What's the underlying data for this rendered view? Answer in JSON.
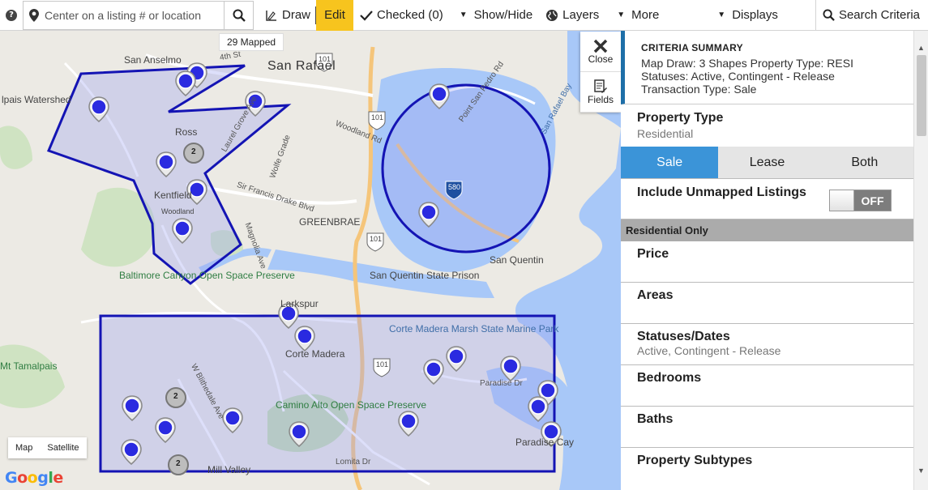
{
  "toolbar": {
    "help_icon": "?",
    "search_placeholder": "Center on a listing # or location",
    "draw_label": "Draw",
    "edit_label": "Edit",
    "checked_label": "Checked (0)",
    "showhide_label": "Show/Hide",
    "layers_label": "Layers",
    "more_label": "More",
    "displays_label": "Displays",
    "search_criteria_label": "Search Criteria"
  },
  "map": {
    "mapped_badge": "29 Mapped",
    "map_type_options": [
      "Map",
      "Satellite"
    ],
    "google_logo": "Google",
    "places": {
      "san_anselmo": "San Anselmo",
      "san_rafael": "San Rafael",
      "ipais_watershed": "lpais Watershed",
      "ross": "Ross",
      "kentfield": "Kentfield",
      "woodland": "Woodland",
      "greenbrae": "GREENBRAE",
      "san_quentin": "San Quentin",
      "san_quentin_prison": "San Quentin State Prison",
      "baltimore": "Baltimore Canyon Open Space Preserve",
      "larkspur": "Larkspur",
      "corte_madera": "Corte Madera",
      "corte_madera_marsh": "Corte Madera Marsh State Marine Park",
      "mt_tamalpais": "Mt Tamalpais",
      "camino_alto": "Camino Alto Open Space Preserve",
      "mill_valley": "Mill Valley",
      "paradise_cay": "Paradise Cay",
      "san_rafael_bay": "San Rafael Bay",
      "fourth_st": "4th St",
      "laurel_grove": "Laurel Grove Ave",
      "sir_francis": "Sir Francis Drake Blvd",
      "magnolia": "Magnolia Ave",
      "wolfe_grade": "Wolfe Grade",
      "woodland_rd": "Woodland Rd",
      "point_san_pedro": "Point San Pedro Rd",
      "paradise_dr": "Paradise Dr",
      "lomita": "Lomita Dr",
      "e_blithedale": "W Blithedale Ave"
    },
    "shields": [
      "101",
      "101",
      "101",
      "101",
      "580"
    ],
    "cluster_counts": [
      "2",
      "2",
      "2"
    ]
  },
  "side_tools": {
    "close_label": "Close",
    "fields_label": "Fields"
  },
  "panel": {
    "summary_title": "CRITERIA SUMMARY",
    "summary_line1": "Map Draw: 3 Shapes   Property Type: RESI",
    "summary_line2": "Statuses: Active, Contingent - Release",
    "summary_line3": "Transaction Type: Sale",
    "property_type_title": "Property Type",
    "property_type_value": "Residential",
    "transaction_options": [
      "Sale",
      "Lease",
      "Both"
    ],
    "transaction_selected": "Sale",
    "unmapped_label": "Include Unmapped Listings",
    "unmapped_toggle": "OFF",
    "residential_only": "Residential Only",
    "criteria": [
      {
        "title": "Price",
        "sub": ""
      },
      {
        "title": "Areas",
        "sub": ""
      },
      {
        "title": "Statuses/Dates",
        "sub": "Active, Contingent - Release"
      },
      {
        "title": "Bedrooms",
        "sub": ""
      },
      {
        "title": "Baths",
        "sub": ""
      },
      {
        "title": "Property Subtypes",
        "sub": ""
      }
    ]
  },
  "colors": {
    "accent_blue": "#3b94d8",
    "edit_yellow": "#f7c41e",
    "shape_stroke": "#1414b4",
    "shape_fill": "#9fa3f0",
    "marker_blue": "#2a2ae0",
    "water": "#a8c8f8"
  }
}
